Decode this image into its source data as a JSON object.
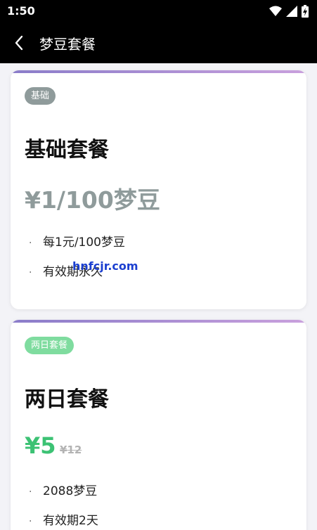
{
  "status_bar": {
    "time": "1:50"
  },
  "app_bar": {
    "title": "梦豆套餐"
  },
  "cards": [
    {
      "badge": "基础",
      "badge_color": "#8f9b9b",
      "name": "基础套餐",
      "price": "¥1/100梦豆",
      "price_color": "#8f9b9b",
      "features": [
        "每1元/100梦豆",
        "有效期永久"
      ]
    },
    {
      "badge": "两日套餐",
      "badge_color": "#7fdc9f",
      "name": "两日套餐",
      "price": "¥5",
      "price_color": "#3cc274",
      "original_price": "¥12",
      "features": [
        "2088梦豆",
        "有效期2天"
      ]
    }
  ],
  "watermark": "hnfcjr.com",
  "colors": {
    "accent_gradient_start": "#8a7cc9",
    "accent_gradient_end": "#c9a0dd"
  }
}
